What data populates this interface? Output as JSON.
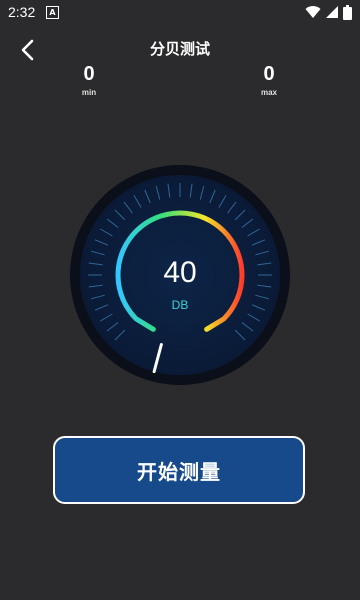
{
  "status_bar": {
    "time": "2:32",
    "app_icon_letter": "A",
    "icons": [
      "wifi-icon",
      "signal-icon",
      "battery-icon"
    ]
  },
  "header": {
    "title": "分贝测试",
    "back_icon": "chevron-left-icon"
  },
  "stats": {
    "min": {
      "value": "0",
      "label": "min"
    },
    "max": {
      "value": "0",
      "label": "max"
    }
  },
  "gauge": {
    "value": "40",
    "unit": "DB",
    "pointer_fraction": 0.0,
    "colors": {
      "outer_ring": "#0b0f1a",
      "face": "#0b1f3f",
      "ticks": "#3f7fb7",
      "gradient_start": "#35c6ff",
      "gradient_mid": "#33e07a",
      "gradient_yellow": "#f3e62a",
      "gradient_end": "#ff3b2b",
      "needle": "#ffffff"
    }
  },
  "actions": {
    "start_label": "开始测量"
  },
  "colors": {
    "background": "#2b2b2d",
    "button": "#164a8b"
  }
}
